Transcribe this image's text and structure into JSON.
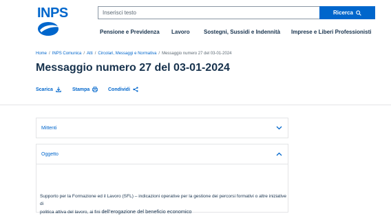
{
  "logo": {
    "text": "INPS"
  },
  "search": {
    "placeholder": "Inserisci testo",
    "button_label": "Ricerca"
  },
  "nav": {
    "items": [
      {
        "label": "Pensione e Previdenza"
      },
      {
        "label": "Lavoro"
      },
      {
        "label": "Sostegni, Sussidi e Indennità"
      },
      {
        "label": "Imprese e Liberi Professionisti"
      }
    ]
  },
  "breadcrumb": {
    "items": [
      {
        "label": "Home"
      },
      {
        "label": "INPS Comunica"
      },
      {
        "label": "Atti"
      },
      {
        "label": "Circolari, Messaggi e Normativa"
      },
      {
        "label": "Messaggio numero 27 del 03-01-2024"
      }
    ],
    "separator": "/"
  },
  "page": {
    "title": "Messaggio numero 27 del 03-01-2024"
  },
  "actions": {
    "download": "Scarica",
    "print": "Stampa",
    "share": "Condividi"
  },
  "accordions": {
    "mittenti": {
      "label": "Mittenti"
    },
    "oggetto": {
      "label": "Oggetto"
    }
  },
  "content": {
    "line1": "Supporto per la Formazione ed il Lavoro (SFL) – indicazioni operative per la gestione dei percorsi formativi o altre iniziative di",
    "line2_start": "politica attiva del lavoro, ai fini ",
    "line2_highlight": "dell’erogazione del beneficio economico"
  },
  "colors": {
    "primary": "#0066cc",
    "heading": "#17324d"
  }
}
